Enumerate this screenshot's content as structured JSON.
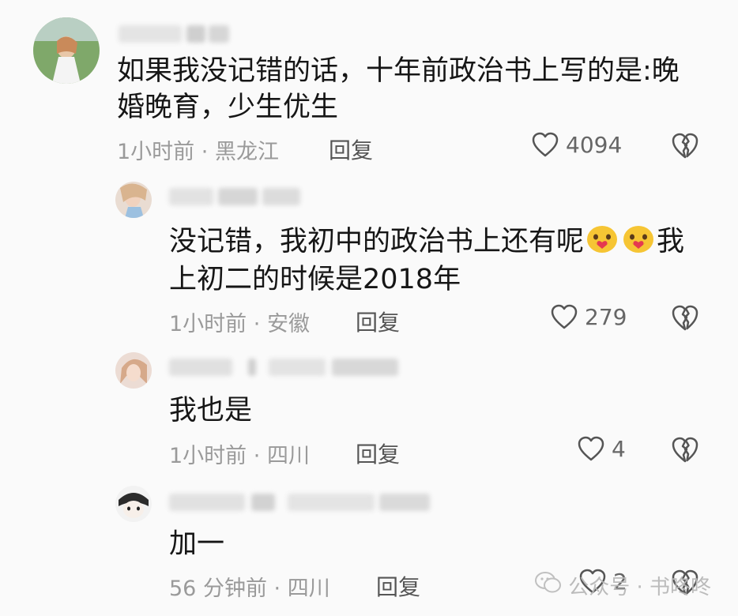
{
  "comments": [
    {
      "text_line1": "如果我没记错的话，十年前政治书上写的是:晚",
      "text_line2": "婚晚育，少生优生",
      "time": "1小时前",
      "separator": "·",
      "location": "黑龙江",
      "reply_label": "回复",
      "likes": "4094"
    },
    {
      "text_before_emoji": "没记错，我初中的政治书上还有呢",
      "text_after_emoji": "我",
      "text_line2": "上初二的时候是2018年",
      "time": "1小时前",
      "separator": "·",
      "location": "安徽",
      "reply_label": "回复",
      "likes": "279"
    },
    {
      "text_line1": "我也是",
      "time": "1小时前",
      "separator": "·",
      "location": "四川",
      "reply_label": "回复",
      "likes": "4"
    },
    {
      "text_line1": "加一",
      "time": "56 分钟前",
      "separator": "·",
      "location": "四川",
      "reply_label": "回复",
      "likes": "2"
    }
  ],
  "watermark": {
    "text": "公众号 · 书咚咚"
  },
  "icons": {
    "like": "heart-outline-icon",
    "dislike": "broken-heart-icon",
    "emoji": "blushing-face-emoji"
  },
  "colors": {
    "background": "#fafafa",
    "text": "#161616",
    "meta": "#9a9a9a"
  }
}
